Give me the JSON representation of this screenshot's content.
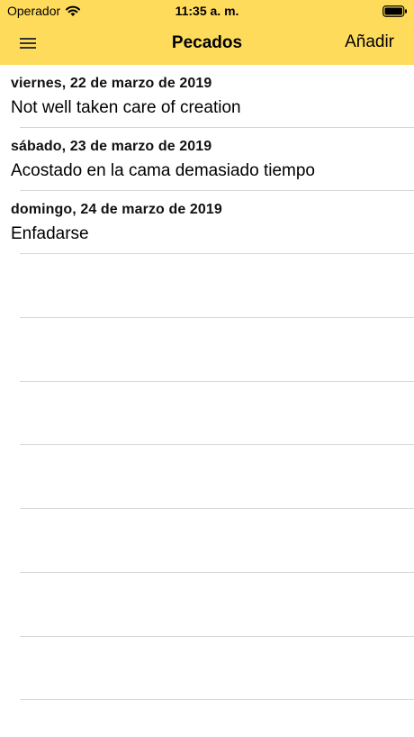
{
  "statusbar": {
    "carrier": "Operador",
    "time": "11:35 a. m."
  },
  "navbar": {
    "title": "Pecados",
    "add_label": "Añadir"
  },
  "entries": [
    {
      "date": "viernes, 22 de marzo de 2019",
      "title": "Not well taken care of creation"
    },
    {
      "date": "sábado, 23 de marzo de 2019",
      "title": "Acostado en la cama demasiado tiempo"
    },
    {
      "date": "domingo, 24 de marzo de 2019",
      "title": "Enfadarse"
    }
  ],
  "colors": {
    "header_bg": "#FFDB5C",
    "separator": "#D6D6D6"
  },
  "icons": {
    "menu": "hamburger-menu-icon",
    "wifi": "wifi-icon",
    "battery": "battery-icon"
  }
}
